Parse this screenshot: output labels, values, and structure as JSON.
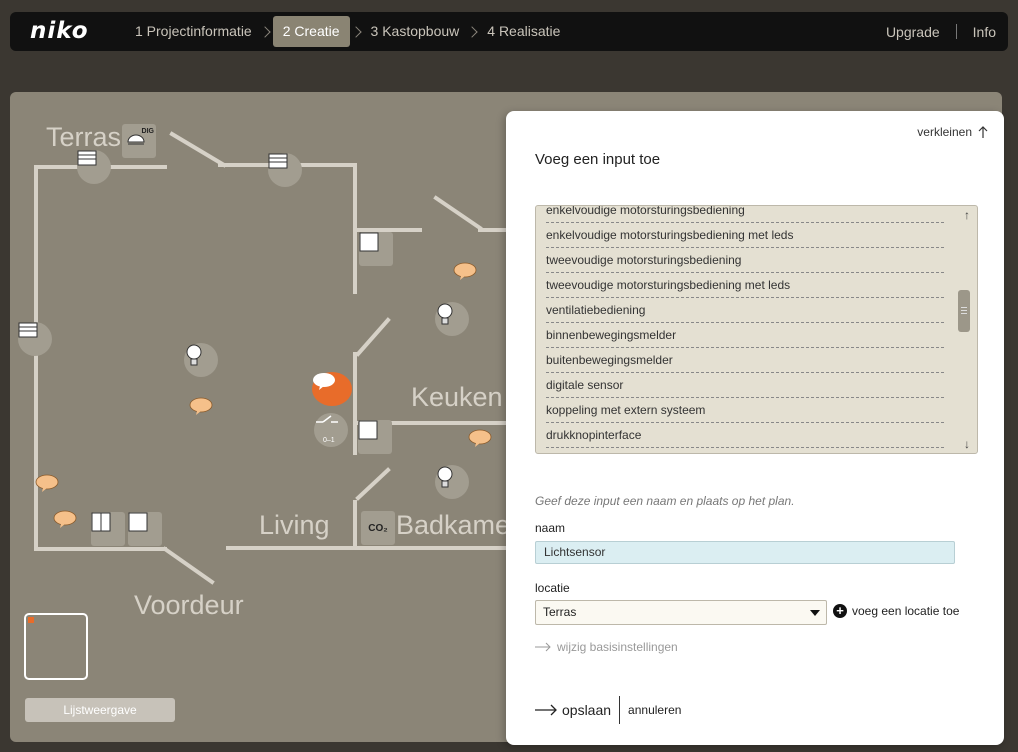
{
  "app": {
    "logo": "niko"
  },
  "nav": {
    "steps": [
      {
        "label": "1 Projectinformatie",
        "active": false
      },
      {
        "label": "2 Creatie",
        "active": true
      },
      {
        "label": "3 Kastopbouw",
        "active": false
      },
      {
        "label": "4 Realisatie",
        "active": false
      }
    ],
    "upgrade": "Upgrade",
    "info": "Info"
  },
  "plan": {
    "rooms": {
      "terras": "Terras",
      "keuken": "Keuken",
      "living": "Living",
      "badkamer": "Badkamer",
      "voordeur": "Voordeur"
    },
    "device_texts": {
      "dig": "DIG",
      "co2": "CO₂",
      "switch": "0–1"
    },
    "list_view_button": "Lijstweergave",
    "accent_color": "#e86c2a"
  },
  "panel": {
    "collapse": "verkleinen",
    "title": "Voeg een input toe",
    "options": [
      "enkelvoudige motorsturingsbediening",
      "enkelvoudige motorsturingsbediening met leds",
      "tweevoudige motorsturingsbediening",
      "tweevoudige motorsturingsbediening met leds",
      "ventilatiebediening",
      "binnenbewegingsmelder",
      "buitenbewegingsmelder",
      "digitale sensor",
      "koppeling met extern systeem",
      "drukknopinterface"
    ],
    "hint": "Geef deze input een naam en plaats op het plan.",
    "name_label": "naam",
    "name_value": "Lichtsensor",
    "location_label": "locatie",
    "location_value": "Terras",
    "add_location": "voeg een locatie toe",
    "basic_settings": "wijzig basisinstellingen",
    "save": "opslaan",
    "cancel": "annuleren"
  }
}
